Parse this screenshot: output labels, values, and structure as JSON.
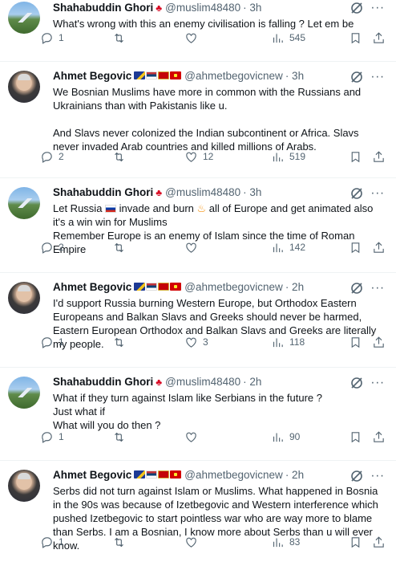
{
  "tweets": [
    {
      "author": "Shahabuddin Ghori",
      "handle": "@muslim48480",
      "time": "· 3h",
      "text": "What's wrong with this an enemy civilisation is falling ? Let em be",
      "replies": "1",
      "retweets": "",
      "likes": "",
      "views": "545"
    },
    {
      "author": "Ahmet Begovic",
      "handle": "@ahmetbegovicnew",
      "time": "· 3h",
      "text": "We Bosnian Muslims have more in common with the Russians and Ukrainians than with Pakistanis like u.\n\nAnd Slavs never colonized the Indian subcontinent or Africa. Slavs never invaded Arab countries and killed millions of Arabs.",
      "replies": "2",
      "retweets": "",
      "likes": "12",
      "views": "519"
    },
    {
      "author": "Shahabuddin Ghori",
      "handle": "@muslim48480",
      "time": "· 3h",
      "text_parts": [
        "Let Russia ",
        " invade and burn ",
        " all of Europe and get animated also it's a win win for Muslims\nRemember Europe is an enemy of Islam since the time of Roman Empire"
      ],
      "replies": "2",
      "retweets": "",
      "likes": "",
      "views": "142"
    },
    {
      "author": "Ahmet Begovic",
      "handle": "@ahmetbegovicnew",
      "time": "· 2h",
      "text": "I'd support Russia burning Western Europe, but Orthodox Eastern Europeans and Balkan Slavs and Greeks should never be harmed, Eastern European Orthodox and Balkan Slavs and Greeks are literally my people.",
      "replies": "1",
      "retweets": "",
      "likes": "3",
      "views": "118"
    },
    {
      "author": "Shahabuddin Ghori",
      "handle": "@muslim48480",
      "time": "· 2h",
      "text": "What if they turn against Islam like Serbians in the future ?\nJust what if\nWhat will you do then ?",
      "replies": "1",
      "retweets": "",
      "likes": "",
      "views": "90"
    },
    {
      "author": "Ahmet Begovic",
      "handle": "@ahmetbegovicnew",
      "time": "· 2h",
      "text": "Serbs did not turn against Islam or Muslims. What happened in Bosnia in the 90s was because of Izetbegovic and Western interference which pushed Izetbegovic to start pointless war who are way more to blame than Serbs. I am a Bosnian, I know more about Serbs than u will ever know.",
      "replies": "1",
      "retweets": "",
      "likes": "",
      "views": "83"
    }
  ],
  "icons": {
    "canada_flag": "maple-leaf-icon",
    "reply": "reply-icon",
    "retweet": "retweet-icon",
    "like": "heart-icon",
    "views": "views-icon",
    "bookmark": "bookmark-icon",
    "share": "share-icon",
    "grok": "grok-icon",
    "more": "more-icon"
  },
  "colors": {
    "text": "#0f1419",
    "secondary": "#536471",
    "divider": "#eff3f4",
    "maple": "#d80621"
  }
}
